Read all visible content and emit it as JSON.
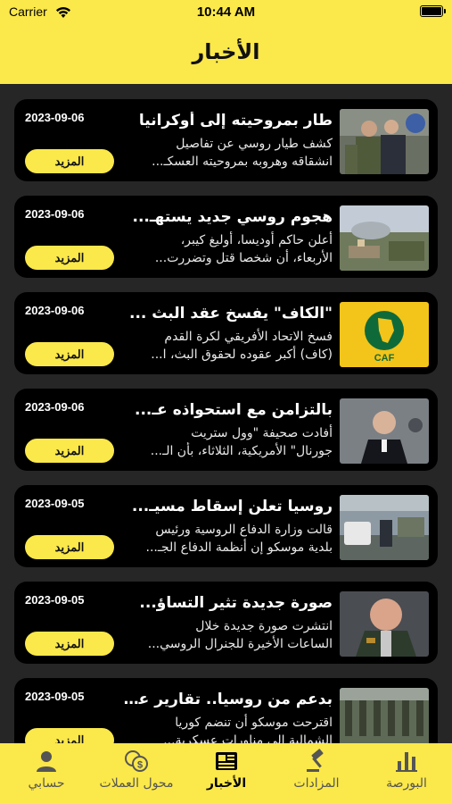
{
  "status_bar": {
    "carrier": "Carrier",
    "time": "10:44 AM"
  },
  "header": {
    "title": "الأخبار"
  },
  "articles": [
    {
      "headline": "طار بمروحيته إلى أوكرانيا",
      "summary_line1": "كشف طيار روسي عن تفاصيل",
      "summary_line2": "انشقاقه وهروبه بمروحيته العسكـ...",
      "date": "2023-09-06",
      "more_label": "المزيد"
    },
    {
      "headline": "هجوم روسي جديد يستهـ...",
      "summary_line1": "أعلن حاكم أوديسا، أوليغ كيبر،",
      "summary_line2": "الأربعاء، أن شخصا قتل وتضررت...",
      "date": "2023-09-06",
      "more_label": "المزيد"
    },
    {
      "headline": "\"الكاف\" يفسخ عقد البث ...",
      "summary_line1": "فسخ الاتحاد الأفريقي لكرة القدم",
      "summary_line2": "(كاف) أكبر عقوده لحقوق البث، ا...",
      "date": "2023-09-06",
      "more_label": "المزيد"
    },
    {
      "headline": "بالتزامن مع استحواذه عـ...",
      "summary_line1": "أفادت صحيفة \"وول ستريت",
      "summary_line2": "جورنال\" الأمريكية، الثلاثاء، بأن الـ...",
      "date": "2023-09-06",
      "more_label": "المزيد"
    },
    {
      "headline": "روسيا تعلن إسقاط مسيـ...",
      "summary_line1": "قالت وزارة الدفاع الروسية ورئيس",
      "summary_line2": "بلدية موسكو إن أنظمة الدفاع الجـ...",
      "date": "2023-09-05",
      "more_label": "المزيد"
    },
    {
      "headline": "صورة جديدة تثير التساؤ...",
      "summary_line1": "انتشرت صورة جديدة خلال",
      "summary_line2": "الساعات الأخيرة للجنرال الروسي...",
      "date": "2023-09-05",
      "more_label": "المزيد"
    },
    {
      "headline": "بدعم من روسيا.. تقارير عـ...",
      "summary_line1": "اقترحت موسكو أن تنضم كوريا",
      "summary_line2": "الشمالية إلى مناورات عسكرية...",
      "date": "2023-09-05",
      "more_label": "المزيد"
    }
  ],
  "caf_logo_text": "CAF",
  "tabs": [
    {
      "label": "حسابي",
      "icon": "person-icon"
    },
    {
      "label": "محول العملات",
      "icon": "currency-exchange-icon"
    },
    {
      "label": "الأخبار",
      "icon": "newspaper-icon",
      "active": true
    },
    {
      "label": "المزادات",
      "icon": "gavel-icon"
    },
    {
      "label": "البورصة",
      "icon": "bar-chart-icon"
    }
  ],
  "colors": {
    "accent": "#fbe84a",
    "card": "#000000",
    "background": "#262626"
  }
}
